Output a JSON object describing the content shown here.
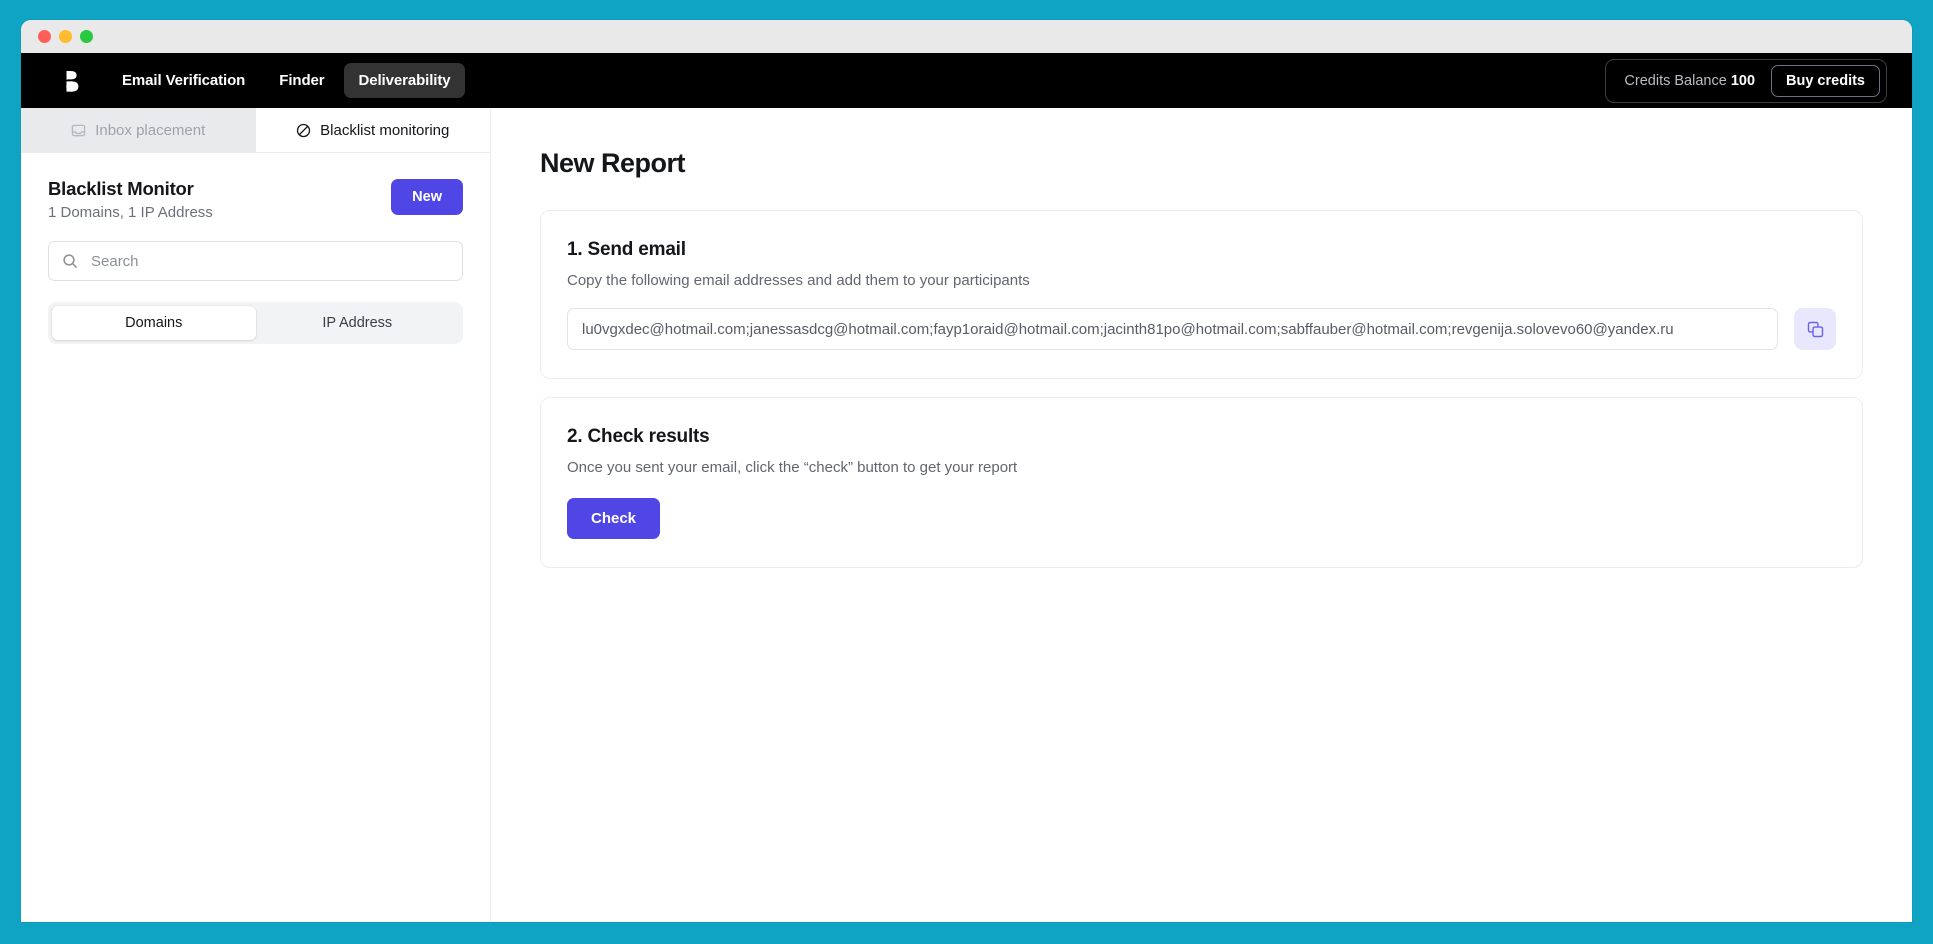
{
  "window": {
    "accent_border_color": "#0fa3c4",
    "titlebar_color": "#e9e9e9",
    "traffic_lights": [
      "close",
      "minimize",
      "maximize"
    ]
  },
  "topnav": {
    "logo_name": "bouncer-logo",
    "items": [
      {
        "label": "Email Verification",
        "active": false
      },
      {
        "label": "Finder",
        "active": false
      },
      {
        "label": "Deliverability",
        "active": true
      }
    ],
    "credits_label": "Credits Balance",
    "credits_value": "100",
    "buy_credits_label": "Buy credits"
  },
  "sidebar": {
    "tabs": [
      {
        "label": "Inbox placement",
        "icon": "inbox-icon",
        "state": "disabled"
      },
      {
        "label": "Blacklist monitoring",
        "icon": "ban-icon",
        "state": "active"
      }
    ],
    "title": "Blacklist Monitor",
    "subtitle": "1 Domains, 1 IP Address",
    "new_button_label": "New",
    "search_placeholder": "Search",
    "segments": [
      {
        "label": "Domains",
        "active": true
      },
      {
        "label": "IP Address",
        "active": false
      }
    ]
  },
  "main": {
    "page_title": "New Report",
    "cards": [
      {
        "title": "1. Send email",
        "description": "Copy the following email addresses and add them to your participants",
        "email_value": "lu0vgxdec@hotmail.com;janessasdcg@hotmail.com;fayp1oraid@hotmail.com;jacinth81po@hotmail.com;sabffauber@hotmail.com;revgenija.solovevo60@yandex.ru",
        "copy_icon": "copy-icon"
      },
      {
        "title": "2. Check results",
        "description": "Once you sent your email, click the “check” button to get your report",
        "check_button_label": "Check"
      }
    ]
  },
  "colors": {
    "accent_purple": "#4f46e5",
    "teal_background": "#0fa3c4",
    "nav_black": "#000000"
  }
}
